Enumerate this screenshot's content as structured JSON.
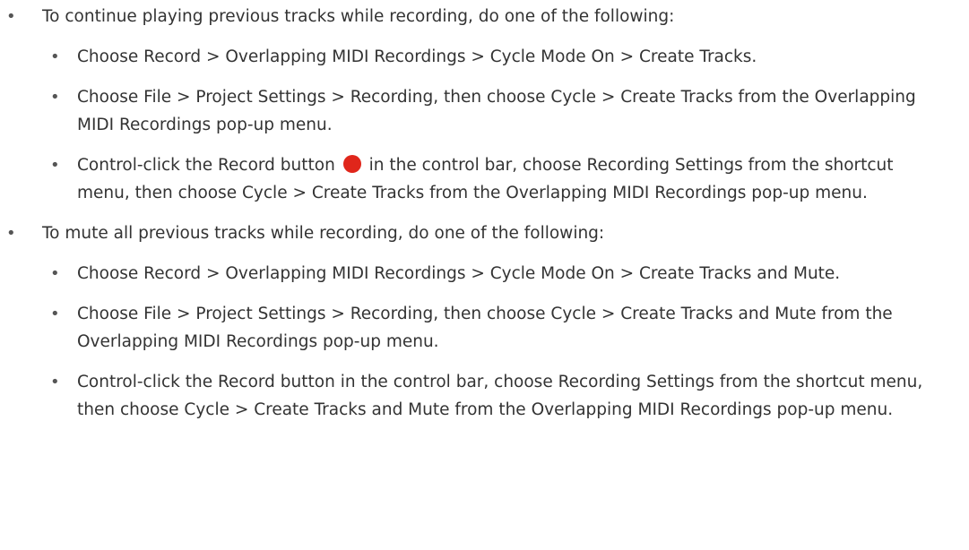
{
  "bullet_glyph": "•",
  "record_button_color": "#e0261b",
  "record_button_icon": "record-button-icon",
  "sections": [
    {
      "intro": "To continue playing previous tracks while recording, do one of the following:",
      "steps": [
        {
          "text": "Choose Record > Overlapping MIDI Recordings > Cycle Mode On > Create Tracks."
        },
        {
          "text": "Choose File > Project Settings > Recording, then choose Cycle > Create Tracks from the Overlapping MIDI Recordings pop-up menu."
        },
        {
          "text_before_icon": "Control-click the Record button",
          "text_after_icon": "in the control bar, choose Recording Settings from the shortcut menu, then choose Cycle > Create Tracks from the Overlapping MIDI Recordings pop-up menu."
        }
      ]
    },
    {
      "intro": "To mute all previous tracks while recording, do one of the following:",
      "steps": [
        {
          "text": "Choose Record > Overlapping MIDI Recordings > Cycle Mode On > Create Tracks and Mute."
        },
        {
          "text": "Choose File > Project Settings > Recording, then choose Cycle > Create Tracks and Mute from the Overlapping MIDI Recordings pop-up menu."
        },
        {
          "text": "Control-click the Record button in the control bar, choose Recording Settings from the shortcut menu, then choose Cycle > Create Tracks and Mute from the Overlapping MIDI Recordings pop-up menu."
        }
      ]
    }
  ]
}
